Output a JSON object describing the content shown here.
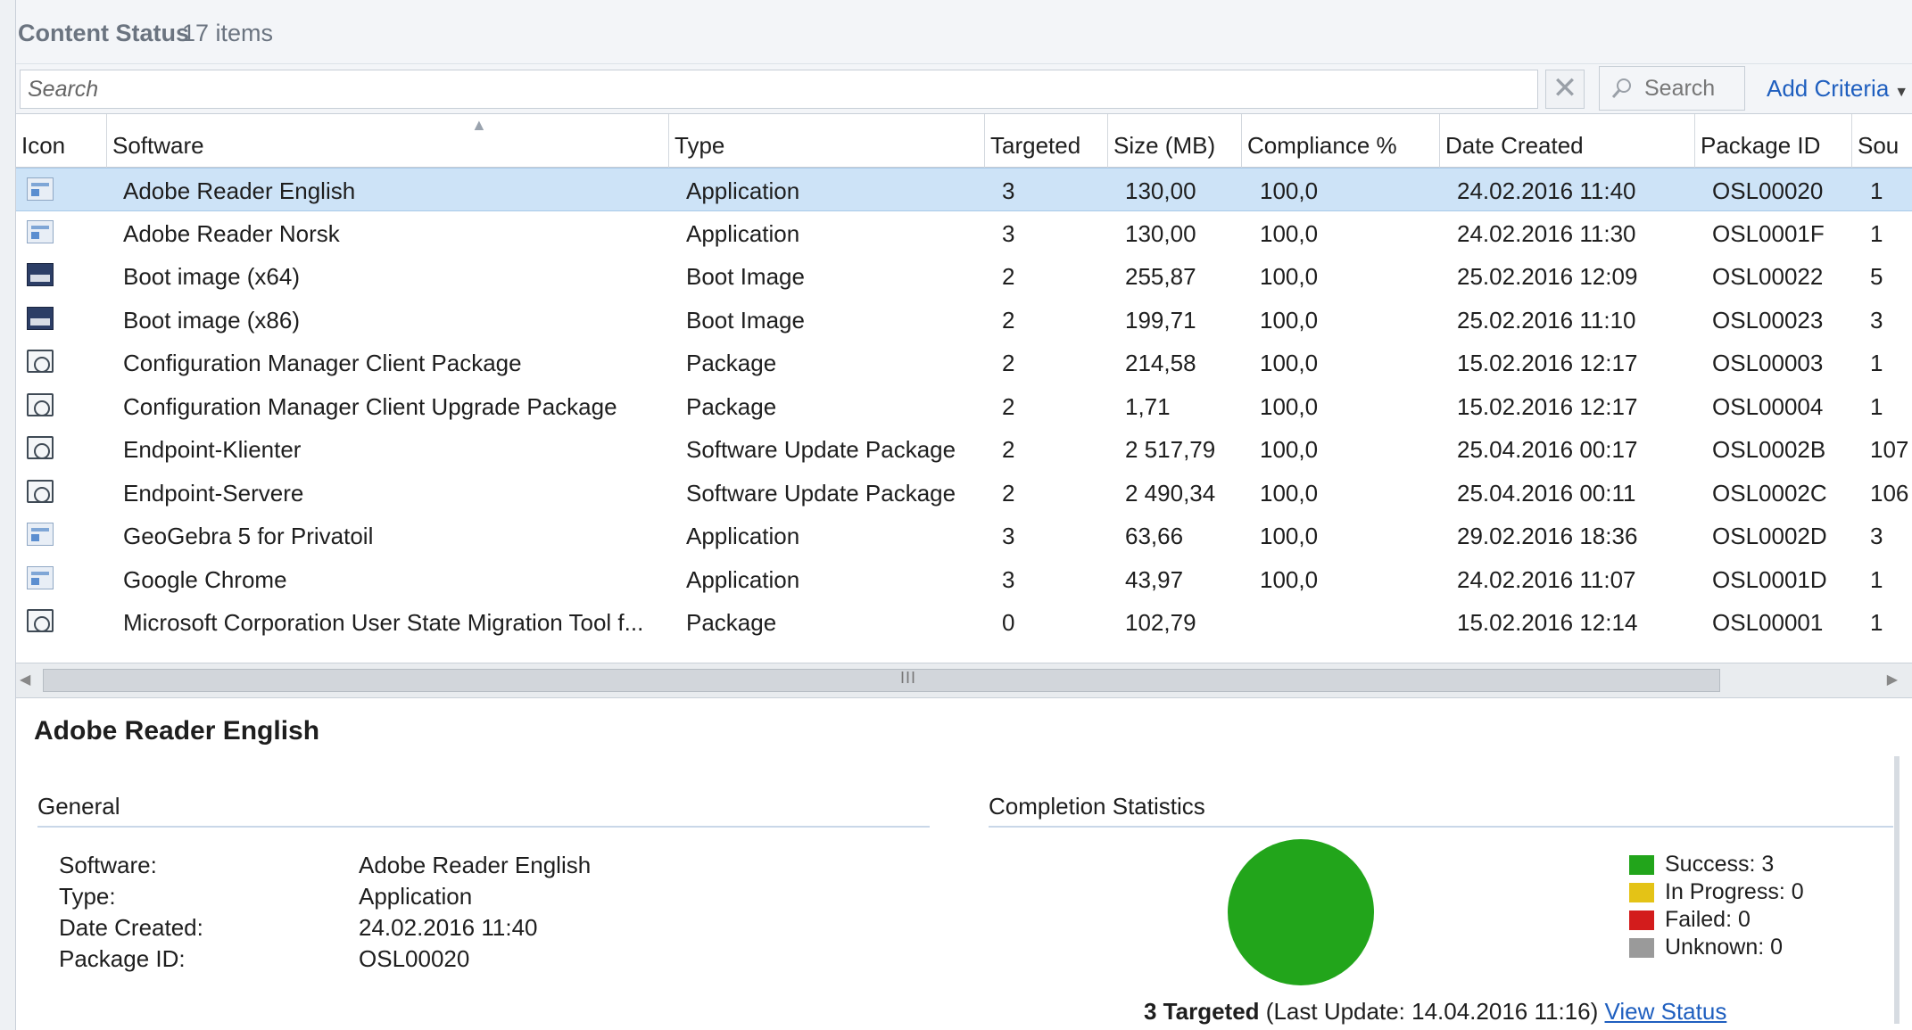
{
  "header": {
    "title": "Content Status",
    "count_label": "17 items"
  },
  "search": {
    "placeholder": "Search",
    "clear_label": "✕",
    "button_label": "Search",
    "add_criteria_label": "Add Criteria"
  },
  "table": {
    "columns": [
      "Icon",
      "Software",
      "Type",
      "Targeted",
      "Size (MB)",
      "Compliance %",
      "Date Created",
      "Package ID",
      "Sou"
    ],
    "rows": [
      {
        "icon": "application-icon",
        "software": "Adobe Reader English",
        "type": "Application",
        "targeted": "3",
        "size": "130,00",
        "compliance": "100,0",
        "date": "24.02.2016 11:40",
        "package_id": "OSL00020",
        "source": "1"
      },
      {
        "icon": "application-icon",
        "software": "Adobe Reader Norsk",
        "type": "Application",
        "targeted": "3",
        "size": "130,00",
        "compliance": "100,0",
        "date": "24.02.2016 11:30",
        "package_id": "OSL0001F",
        "source": "1"
      },
      {
        "icon": "boot-image-icon",
        "software": "Boot image (x64)",
        "type": "Boot Image",
        "targeted": "2",
        "size": "255,87",
        "compliance": "100,0",
        "date": "25.02.2016 12:09",
        "package_id": "OSL00022",
        "source": "5"
      },
      {
        "icon": "boot-image-icon",
        "software": "Boot image (x86)",
        "type": "Boot Image",
        "targeted": "2",
        "size": "199,71",
        "compliance": "100,0",
        "date": "25.02.2016 11:10",
        "package_id": "OSL00023",
        "source": "3"
      },
      {
        "icon": "package-icon",
        "software": "Configuration Manager Client Package",
        "type": "Package",
        "targeted": "2",
        "size": "214,58",
        "compliance": "100,0",
        "date": "15.02.2016 12:17",
        "package_id": "OSL00003",
        "source": "1"
      },
      {
        "icon": "package-icon",
        "software": "Configuration Manager Client Upgrade Package",
        "type": "Package",
        "targeted": "2",
        "size": "1,71",
        "compliance": "100,0",
        "date": "15.02.2016 12:17",
        "package_id": "OSL00004",
        "source": "1"
      },
      {
        "icon": "package-icon",
        "software": "Endpoint-Klienter",
        "type": "Software Update Package",
        "targeted": "2",
        "size": "2 517,79",
        "compliance": "100,0",
        "date": "25.04.2016 00:17",
        "package_id": "OSL0002B",
        "source": "107"
      },
      {
        "icon": "package-icon",
        "software": "Endpoint-Servere",
        "type": "Software Update Package",
        "targeted": "2",
        "size": "2 490,34",
        "compliance": "100,0",
        "date": "25.04.2016 00:11",
        "package_id": "OSL0002C",
        "source": "106"
      },
      {
        "icon": "application-icon",
        "software": "GeoGebra 5 for Privatoil",
        "type": "Application",
        "targeted": "3",
        "size": "63,66",
        "compliance": "100,0",
        "date": "29.02.2016 18:36",
        "package_id": "OSL0002D",
        "source": "3"
      },
      {
        "icon": "application-icon",
        "software": "Google Chrome",
        "type": "Application",
        "targeted": "3",
        "size": "43,97",
        "compliance": "100,0",
        "date": "24.02.2016 11:07",
        "package_id": "OSL0001D",
        "source": "1"
      },
      {
        "icon": "package-icon",
        "software": "Microsoft Corporation User State Migration Tool f...",
        "type": "Package",
        "targeted": "0",
        "size": "102,79",
        "compliance": "",
        "date": "15.02.2016 12:14",
        "package_id": "OSL00001",
        "source": "1"
      }
    ]
  },
  "scrollbar": {
    "grip": "III"
  },
  "details": {
    "title": "Adobe Reader English",
    "general_heading": "General",
    "fields": [
      {
        "label": "Software:",
        "value": "Adobe Reader English"
      },
      {
        "label": "Type:",
        "value": "Application"
      },
      {
        "label": "Date Created:",
        "value": "24.02.2016 11:40"
      },
      {
        "label": "Package ID:",
        "value": "OSL00020"
      }
    ],
    "stats_heading": "Completion Statistics",
    "legend": [
      {
        "label": "Success: 3",
        "color": "#22a51b",
        "value": 3
      },
      {
        "label": "In Progress: 0",
        "color": "#e4c316",
        "value": 0
      },
      {
        "label": "Failed: 0",
        "color": "#d31c1c",
        "value": 0
      },
      {
        "label": "Unknown: 0",
        "color": "#9a9a9a",
        "value": 0
      }
    ],
    "targeted_label": "3 Targeted",
    "last_update": "(Last Update: 14.04.2016 11:16)",
    "view_status_label": "View Status"
  }
}
